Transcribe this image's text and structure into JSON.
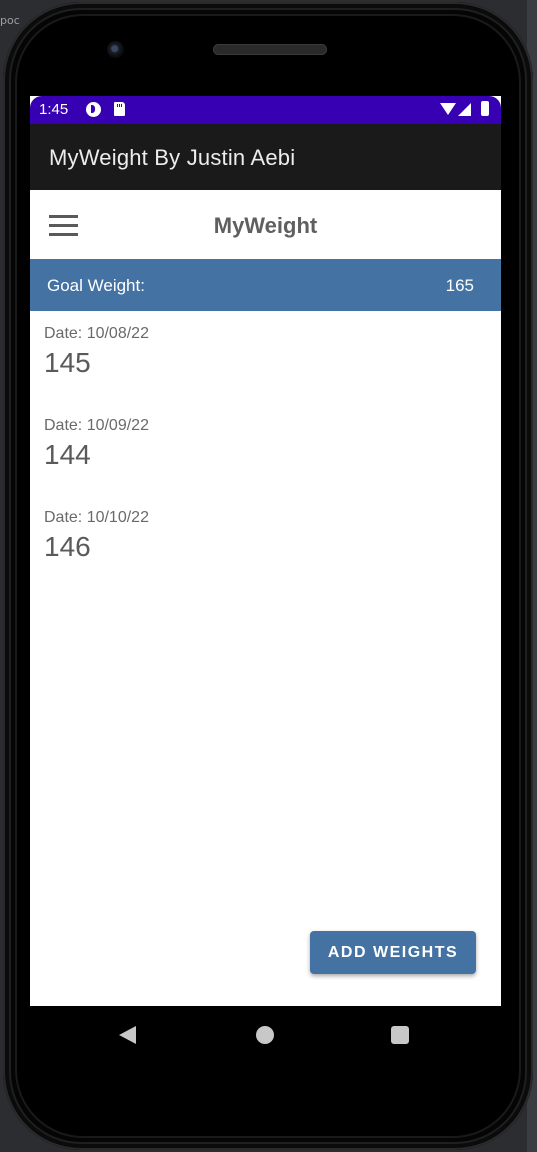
{
  "desktop": {
    "left_text": "poc"
  },
  "status_bar": {
    "time": "1:45"
  },
  "app_bar": {
    "title": "MyWeight By Justin Aebi"
  },
  "toolbar": {
    "title": "MyWeight"
  },
  "goal": {
    "label": "Goal Weight:",
    "value": "165"
  },
  "entries": [
    {
      "date": "Date: 10/08/22",
      "weight": "145"
    },
    {
      "date": "Date: 10/09/22",
      "weight": "144"
    },
    {
      "date": "Date: 10/10/22",
      "weight": "146"
    }
  ],
  "actions": {
    "add_weights_label": "ADD WEIGHTS"
  },
  "colors": {
    "status_bar": "#3700b3",
    "app_bar": "#1a1a1a",
    "accent": "#4372a3"
  }
}
